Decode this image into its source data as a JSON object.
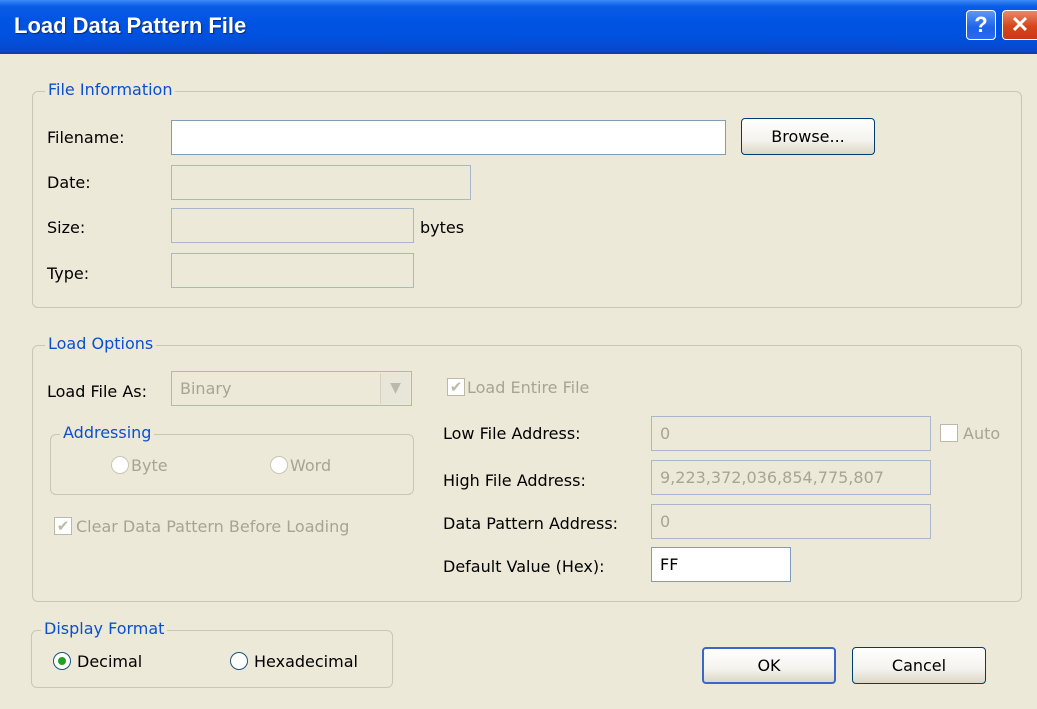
{
  "window": {
    "title": "Load Data Pattern File",
    "help_glyph": "?",
    "close_glyph": "✕"
  },
  "file_info": {
    "legend": "File Information",
    "filename_label": "Filename:",
    "filename_value": "",
    "browse_label": "Browse...",
    "date_label": "Date:",
    "date_value": "",
    "size_label": "Size:",
    "size_value": "",
    "size_unit": "bytes",
    "type_label": "Type:",
    "type_value": ""
  },
  "load_options": {
    "legend": "Load Options",
    "load_as_label": "Load File As:",
    "load_as_value": "Binary",
    "load_entire_label": "Load Entire File",
    "load_entire_checked": true,
    "addressing": {
      "legend": "Addressing",
      "byte_label": "Byte",
      "word_label": "Word"
    },
    "clear_label": "Clear Data Pattern Before Loading",
    "clear_checked": true,
    "low_addr_label": "Low File Address:",
    "low_addr_value": "0",
    "auto_label": "Auto",
    "high_addr_label": "High File Address:",
    "high_addr_value": "9,223,372,036,854,775,807",
    "dp_addr_label": "Data Pattern Address:",
    "dp_addr_value": "0",
    "default_value_label": "Default Value (Hex):",
    "default_value": "FF"
  },
  "display_format": {
    "legend": "Display Format",
    "decimal_label": "Decimal",
    "hex_label": "Hexadecimal",
    "selected": "Decimal"
  },
  "buttons": {
    "ok": "OK",
    "cancel": "Cancel"
  },
  "colors": {
    "titlebar": "#0054e3",
    "dialog_bg": "#ece9d8",
    "legend_text": "#0b4fd1",
    "disabled_text": "#a7a496"
  }
}
